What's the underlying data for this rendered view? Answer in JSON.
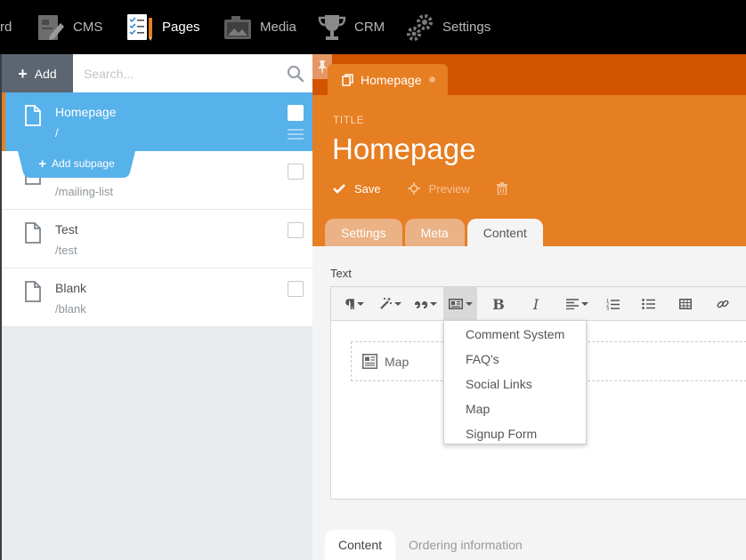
{
  "nav": {
    "items": [
      {
        "label": "rd",
        "icon": "dashboard-icon"
      },
      {
        "label": "CMS",
        "icon": "cms-icon"
      },
      {
        "label": "Pages",
        "icon": "pages-icon"
      },
      {
        "label": "Media",
        "icon": "media-icon"
      },
      {
        "label": "CRM",
        "icon": "trophy-icon"
      },
      {
        "label": "Settings",
        "icon": "gears-icon"
      }
    ],
    "active": "Pages"
  },
  "sidebar": {
    "add_label": "Add",
    "search_placeholder": "Search...",
    "add_subpage_label": "Add subpage",
    "pages": [
      {
        "title": "Homepage",
        "path": "/",
        "active": true
      },
      {
        "title": "",
        "path": "/mailing-list",
        "active": false
      },
      {
        "title": "Test",
        "path": "/test",
        "active": false
      },
      {
        "title": "Blank",
        "path": "/blank",
        "active": false
      }
    ]
  },
  "editor": {
    "open_tab": "Homepage",
    "title_label": "TITLE",
    "page_title": "Homepage",
    "actions": {
      "save": "Save",
      "preview": "Preview"
    },
    "tabs": [
      {
        "label": "Settings",
        "active": false
      },
      {
        "label": "Meta",
        "active": false
      },
      {
        "label": "Content",
        "active": true
      }
    ],
    "text_label": "Text",
    "toolbar": {
      "bold": "B",
      "italic": "I"
    },
    "widget_label": "Map",
    "dropdown": [
      "Comment System",
      "FAQ's",
      "Social Links",
      "Map",
      "Signup Form"
    ],
    "bottom_tabs": [
      {
        "label": "Content",
        "active": true
      },
      {
        "label": "Ordering information",
        "active": false
      }
    ]
  },
  "colors": {
    "accent": "#e67e22",
    "accent_dark": "#d35400",
    "selection": "#57b1ea",
    "topbar": "#000000"
  }
}
